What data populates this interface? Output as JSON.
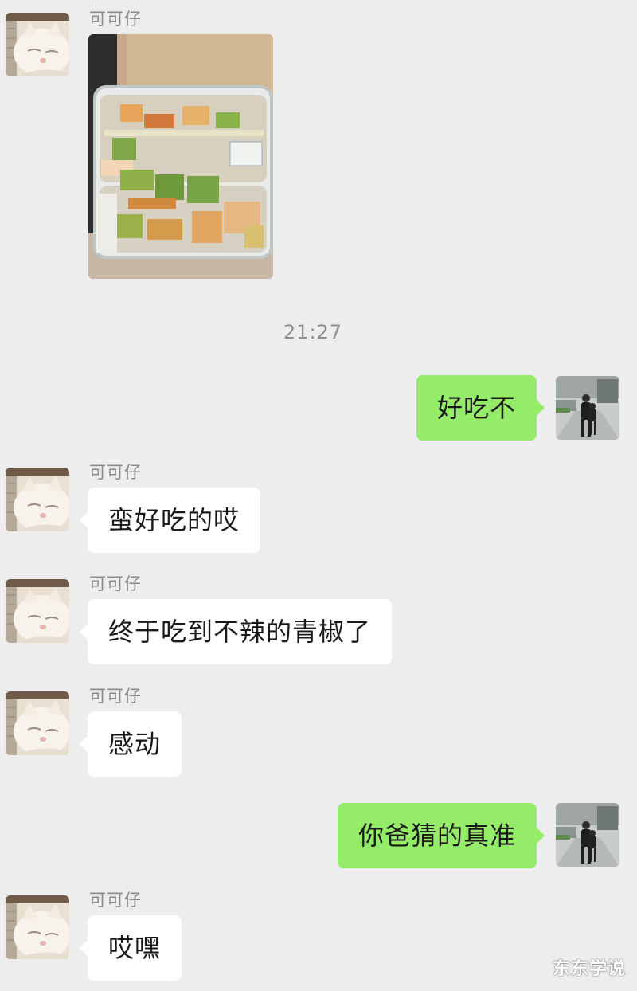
{
  "chat": {
    "contact_name": "可可仔",
    "timestamp": "21:27",
    "messages": [
      {
        "sender": "contact",
        "type": "image",
        "content": "food-container-photo"
      },
      {
        "sender": "me",
        "type": "text",
        "text": "好吃不"
      },
      {
        "sender": "contact",
        "type": "text",
        "text": "蛮好吃的哎"
      },
      {
        "sender": "contact",
        "type": "text",
        "text": "终于吃到不辣的青椒了"
      },
      {
        "sender": "contact",
        "type": "text",
        "text": "感动"
      },
      {
        "sender": "me",
        "type": "text",
        "text": "你爸猜的真准"
      },
      {
        "sender": "contact",
        "type": "text",
        "text": "哎嘿"
      }
    ]
  },
  "watermark": "东东学说",
  "colors": {
    "background": "#ededed",
    "incoming_bubble": "#ffffff",
    "outgoing_bubble": "#95ec69"
  },
  "icons": {
    "contact_avatar": "cat-face-avatar",
    "my_avatar": "person-photo-avatar"
  }
}
